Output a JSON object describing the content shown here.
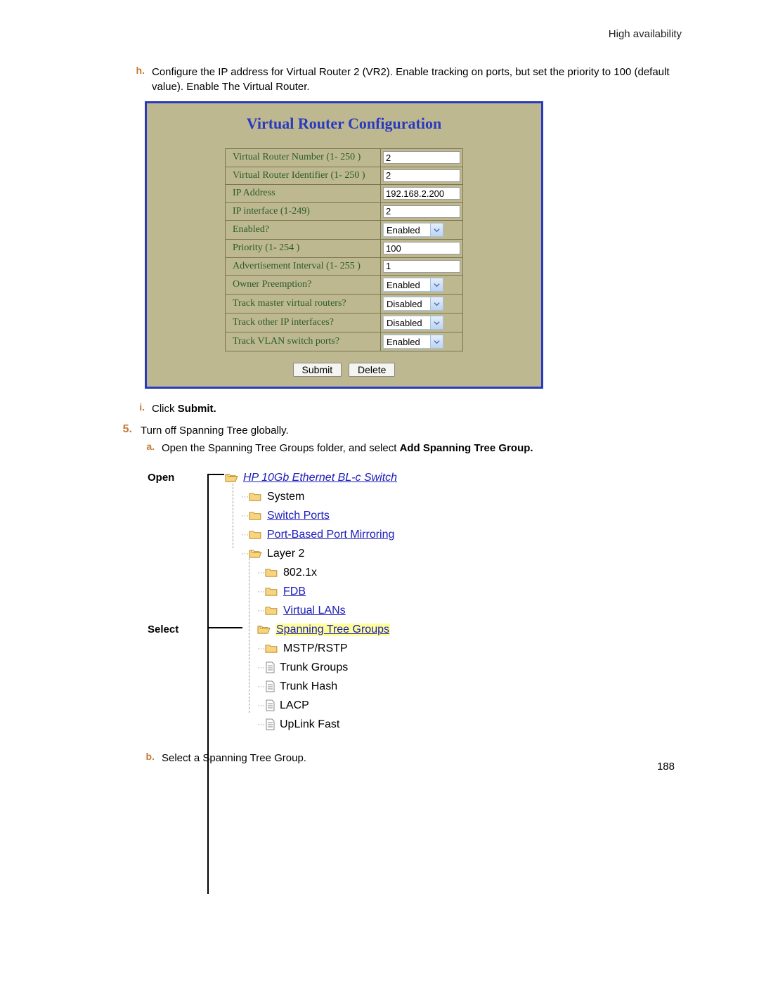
{
  "header": "High availability",
  "step_h": {
    "marker": "h.",
    "text_before": "Configure the IP address for Virtual Router 2 (VR2). Enable tracking on ports, but set the priority to 100 (default value). Enable The Virtual Router."
  },
  "config": {
    "title": "Virtual Router Configuration",
    "rows": [
      {
        "label": "Virtual Router Number  (1- 250 )",
        "type": "text",
        "value": "2"
      },
      {
        "label": "Virtual Router Identifier (1- 250 )",
        "type": "text",
        "value": "2"
      },
      {
        "label": "IP Address",
        "type": "text",
        "value": "192.168.2.200"
      },
      {
        "label": "IP interface (1-249)",
        "type": "text",
        "value": "2"
      },
      {
        "label": "Enabled?",
        "type": "select",
        "value": "Enabled"
      },
      {
        "label": "Priority (1- 254 )",
        "type": "text",
        "value": "100"
      },
      {
        "label": "Advertisement Interval (1- 255 )",
        "type": "text",
        "value": "1"
      },
      {
        "label": "Owner Preemption?",
        "type": "select",
        "value": "Enabled"
      },
      {
        "label": "Track master virtual routers?",
        "type": "select",
        "value": "Disabled"
      },
      {
        "label": "Track other IP interfaces?",
        "type": "select",
        "value": "Disabled"
      },
      {
        "label": "Track VLAN switch ports?",
        "type": "select",
        "value": "Enabled"
      }
    ],
    "buttons": {
      "submit": "Submit",
      "delete": "Delete"
    }
  },
  "step_i": {
    "marker": "i.",
    "pre": "Click ",
    "bold": "Submit."
  },
  "step_5": {
    "marker": "5.",
    "text": "Turn off Spanning Tree globally."
  },
  "step_a": {
    "marker": "a.",
    "pre": "Open the Spanning Tree Groups folder, and select ",
    "bold": "Add Spanning Tree Group."
  },
  "tree": {
    "open_label": "Open",
    "select_label": "Select",
    "items": [
      {
        "indent": 0,
        "icon": "folder-open",
        "text": "HP 10Gb Ethernet BL-c Switch",
        "style": "link-italic"
      },
      {
        "indent": 1,
        "icon": "folder",
        "text": "System",
        "style": "plain"
      },
      {
        "indent": 1,
        "icon": "folder",
        "text": "Switch Ports",
        "style": "link"
      },
      {
        "indent": 1,
        "icon": "folder",
        "text": "Port-Based Port Mirroring",
        "style": "link"
      },
      {
        "indent": 1,
        "icon": "folder-open",
        "text": "Layer 2",
        "style": "plain"
      },
      {
        "indent": 2,
        "icon": "folder",
        "text": "802.1x",
        "style": "plain"
      },
      {
        "indent": 2,
        "icon": "folder",
        "text": "FDB",
        "style": "link"
      },
      {
        "indent": 2,
        "icon": "folder",
        "text": "Virtual LANs",
        "style": "link"
      },
      {
        "indent": 2,
        "icon": "folder-open",
        "text": "Spanning Tree Groups",
        "style": "selected"
      },
      {
        "indent": 2,
        "icon": "folder",
        "text": "MSTP/RSTP",
        "style": "plain"
      },
      {
        "indent": 2,
        "icon": "doc",
        "text": "Trunk Groups",
        "style": "plain-tight"
      },
      {
        "indent": 2,
        "icon": "doc",
        "text": "Trunk Hash",
        "style": "plain-tight"
      },
      {
        "indent": 2,
        "icon": "doc",
        "text": "LACP",
        "style": "plain-tight"
      },
      {
        "indent": 2,
        "icon": "doc",
        "text": "UpLink Fast",
        "style": "plain-tight"
      }
    ]
  },
  "step_b": {
    "marker": "b.",
    "text": "Select a Spanning Tree Group."
  },
  "page_number": "188"
}
